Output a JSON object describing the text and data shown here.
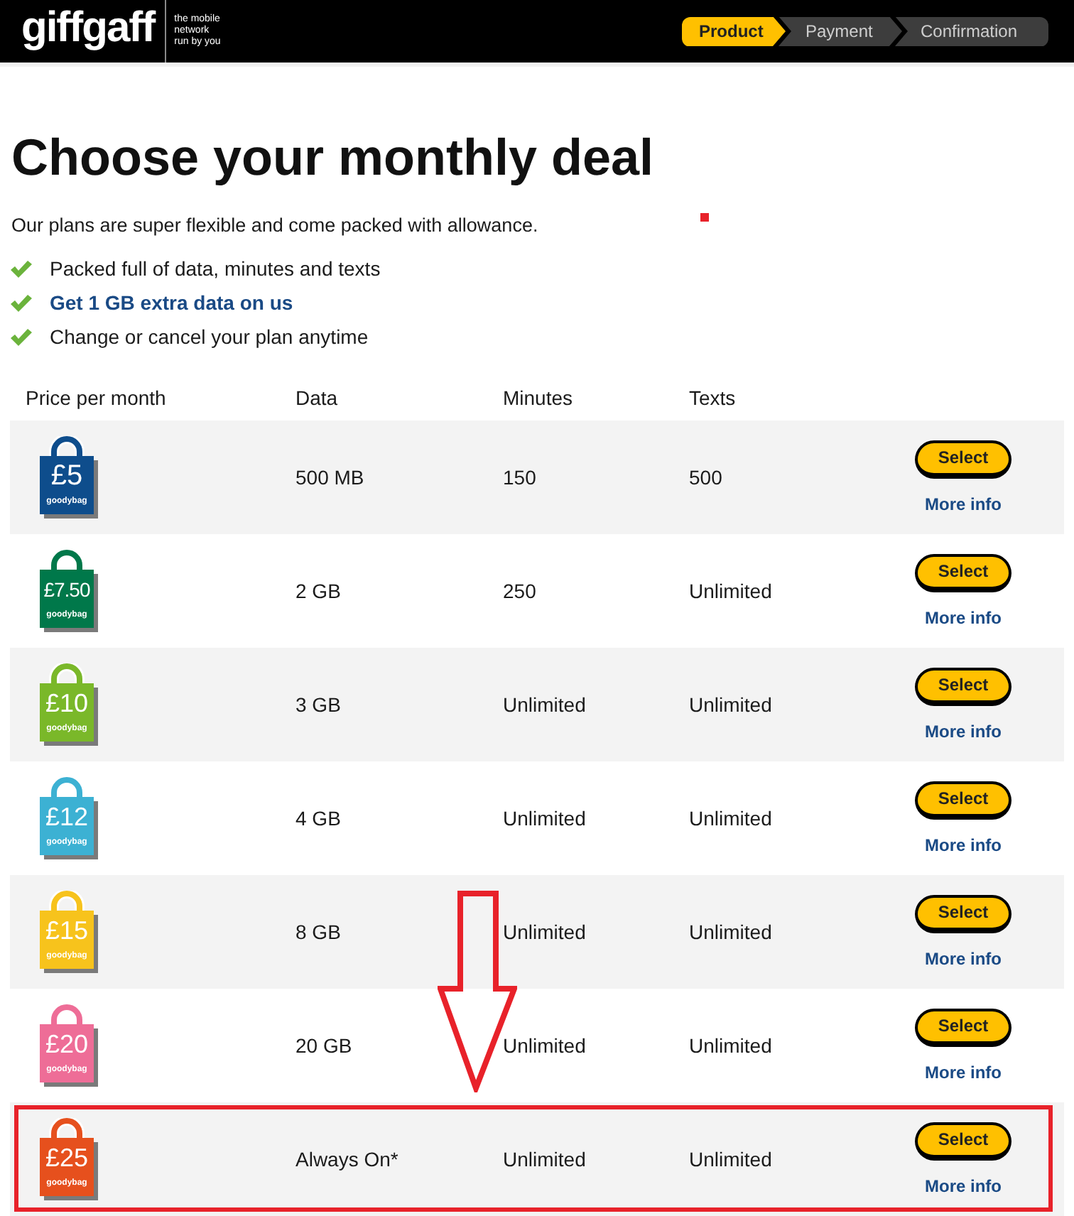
{
  "header": {
    "logo": "giffgaff",
    "tagline": [
      "the mobile",
      "network",
      "run by you"
    ],
    "steps": [
      {
        "label": "Product",
        "selected": true
      },
      {
        "label": "Payment",
        "selected": false
      },
      {
        "label": "Confirmation",
        "selected": false
      }
    ]
  },
  "title": "Choose your monthly deal",
  "intro": "Our plans are super flexible and come packed with allowance.",
  "features": [
    {
      "text": "Packed full of data, minutes and texts",
      "emphasized": false
    },
    {
      "text": "Get 1 GB extra data on us",
      "emphasized": true
    },
    {
      "text": "Change or cancel your plan anytime",
      "emphasized": false
    }
  ],
  "table": {
    "columns": [
      "Price per month",
      "Data",
      "Minutes",
      "Texts"
    ],
    "rows": [
      {
        "price": "£5",
        "bag_label": "goodybag",
        "color": "#0e4d8c",
        "data": "500 MB",
        "minutes": "150",
        "texts": "500",
        "button": "Select",
        "link": "More info",
        "highlighted": false
      },
      {
        "price": "£7.50",
        "bag_label": "goodybag",
        "color": "#00784a",
        "data": "2 GB",
        "minutes": "250",
        "texts": "Unlimited",
        "button": "Select",
        "link": "More info",
        "highlighted": false
      },
      {
        "price": "£10",
        "bag_label": "goodybag",
        "color": "#7ab829",
        "data": "3 GB",
        "minutes": "Unlimited",
        "texts": "Unlimited",
        "button": "Select",
        "link": "More info",
        "highlighted": false
      },
      {
        "price": "£12",
        "bag_label": "goodybag",
        "color": "#3cb1d3",
        "data": "4 GB",
        "minutes": "Unlimited",
        "texts": "Unlimited",
        "button": "Select",
        "link": "More info",
        "highlighted": false
      },
      {
        "price": "£15",
        "bag_label": "goodybag",
        "color": "#f7c31c",
        "data": "8 GB",
        "minutes": "Unlimited",
        "texts": "Unlimited",
        "button": "Select",
        "link": "More info",
        "highlighted": false
      },
      {
        "price": "£20",
        "bag_label": "goodybag",
        "color": "#ee6d97",
        "data": "20 GB",
        "minutes": "Unlimited",
        "texts": "Unlimited",
        "button": "Select",
        "link": "More info",
        "highlighted": false
      },
      {
        "price": "£25",
        "bag_label": "goodybag",
        "color": "#e6501d",
        "data": "Always On*",
        "minutes": "Unlimited",
        "texts": "Unlimited",
        "button": "Select",
        "link": "More info",
        "highlighted": true
      }
    ]
  },
  "annotations": {
    "arrow": true,
    "marker": true
  }
}
